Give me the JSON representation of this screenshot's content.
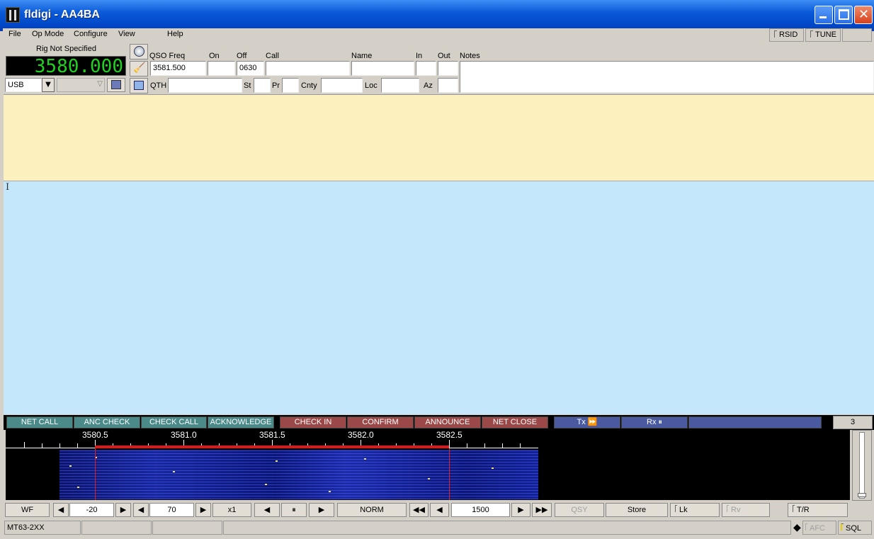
{
  "window": {
    "title": "fldigi - AA4BA"
  },
  "menu": {
    "file": "File",
    "opmode": "Op Mode",
    "configure": "Configure",
    "view": "View",
    "help": "Help"
  },
  "toggles": {
    "rsid": "RSID",
    "tune": "TUNE"
  },
  "rig": {
    "name": "Rig Not Specified",
    "frequency": "3580.000",
    "mode": "USB"
  },
  "log": {
    "qso_freq_label": "QSO Freq",
    "qso_freq": "3581.500",
    "on_label": "On",
    "on": "",
    "off_label": "Off",
    "off": "0630",
    "call_label": "Call",
    "call": "",
    "name_label": "Name",
    "name": "",
    "in_label": "In",
    "in": "",
    "out_label": "Out",
    "out": "",
    "notes_label": "Notes",
    "notes": "",
    "qth_label": "QTH",
    "qth": "",
    "st_label": "St",
    "st": "",
    "pr_label": "Pr",
    "pr": "",
    "cnty_label": "Cnty",
    "cnty": "",
    "loc_label": "Loc",
    "loc": "",
    "az_label": "Az",
    "az": ""
  },
  "macros": [
    {
      "label": "NET CALL",
      "color": "#4a8a88"
    },
    {
      "label": "ANC CHECK",
      "color": "#4a8a88"
    },
    {
      "label": "CHECK CALL",
      "color": "#4a8a88"
    },
    {
      "label": "ACKNOWLEDGE",
      "color": "#4a8a88"
    },
    {
      "label": "CHECK IN",
      "color": "#9a4848"
    },
    {
      "label": "CONFIRM",
      "color": "#9a4848"
    },
    {
      "label": "ANNOUNCE",
      "color": "#9a4848"
    },
    {
      "label": "NET CLOSE",
      "color": "#9a4848"
    },
    {
      "label": "Tx ⏩",
      "color": "#4a5aa0"
    },
    {
      "label": "Rx ⏸",
      "color": "#4a5aa0"
    },
    {
      "label": "",
      "color": "#4a5aa0"
    }
  ],
  "macro_page": "3",
  "scale": {
    "labels": [
      "3580.5",
      "3581.0",
      "3581.5",
      "3582.0",
      "3582.5"
    ]
  },
  "controls": {
    "wf_mode": "WF",
    "ref_level": "-20",
    "ampl_span": "70",
    "zoom": "x1",
    "speed": "NORM",
    "carrier": "1500",
    "qsy": "QSY",
    "store": "Store",
    "lk": "Lk",
    "rv": "Rv",
    "tr": "T/R"
  },
  "status": {
    "mode": "MT63-2XX",
    "afc": "AFC",
    "sql": "SQL"
  },
  "colors": {
    "rx_pane": "#fdf0bf",
    "tx_pane": "#c5e7fb",
    "freq_digits": "#1fd21f"
  }
}
